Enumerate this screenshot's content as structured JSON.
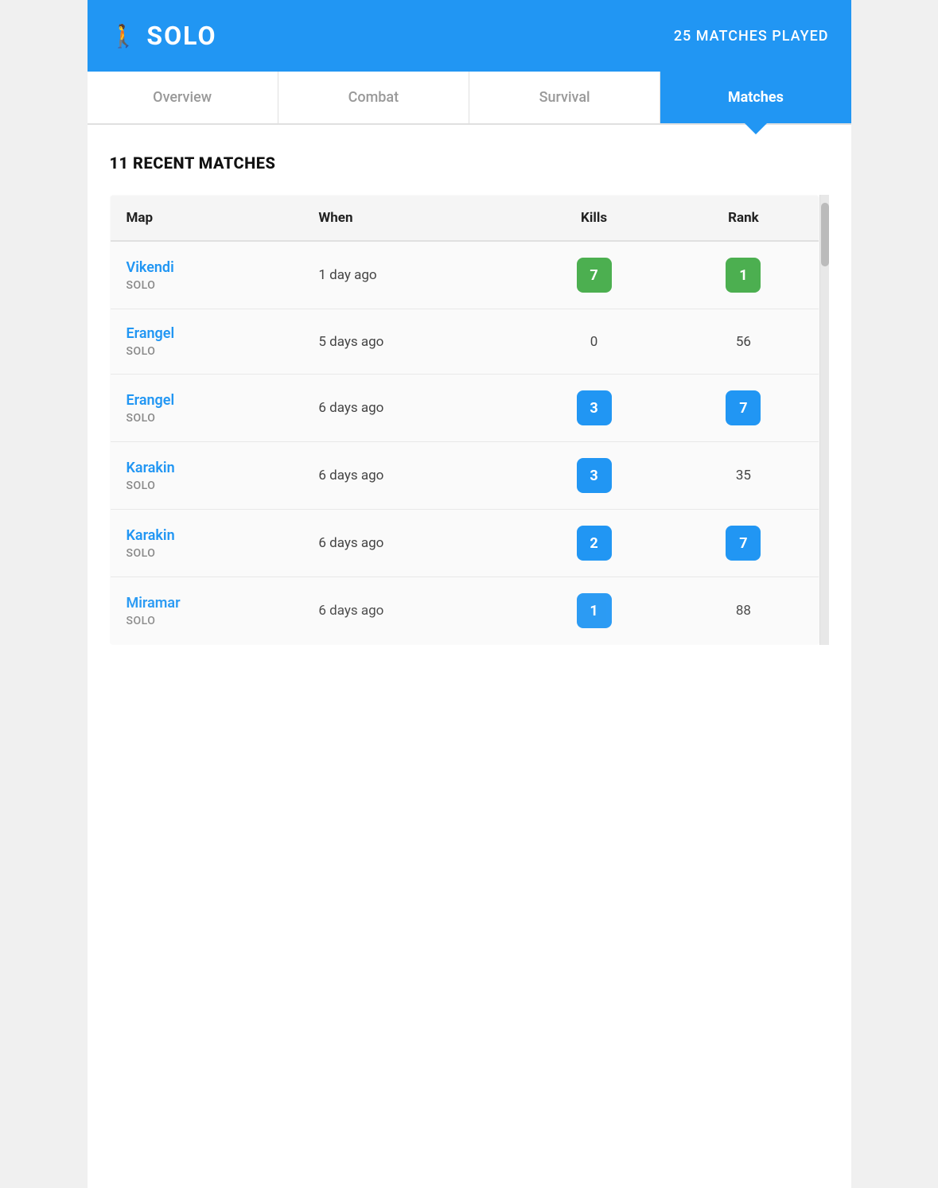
{
  "header": {
    "icon": "🚶",
    "title": "SOLO",
    "matches_played_label": "25 MATCHES PLAYED"
  },
  "tabs": [
    {
      "id": "overview",
      "label": "Overview",
      "active": false
    },
    {
      "id": "combat",
      "label": "Combat",
      "active": false
    },
    {
      "id": "survival",
      "label": "Survival",
      "active": false
    },
    {
      "id": "matches",
      "label": "Matches",
      "active": true
    }
  ],
  "section_title": "11 RECENT MATCHES",
  "table": {
    "columns": [
      "Map",
      "When",
      "Kills",
      "Rank"
    ],
    "rows": [
      {
        "map": "Vikendi",
        "mode": "SOLO",
        "when": "1 day ago",
        "kills": "7",
        "kills_badge": "green",
        "rank": "1",
        "rank_badge": "green"
      },
      {
        "map": "Erangel",
        "mode": "SOLO",
        "when": "5 days ago",
        "kills": "0",
        "kills_badge": null,
        "rank": "56",
        "rank_badge": null
      },
      {
        "map": "Erangel",
        "mode": "SOLO",
        "when": "6 days ago",
        "kills": "3",
        "kills_badge": "blue",
        "rank": "7",
        "rank_badge": "blue"
      },
      {
        "map": "Karakin",
        "mode": "SOLO",
        "when": "6 days ago",
        "kills": "3",
        "kills_badge": "blue",
        "rank": "35",
        "rank_badge": null
      },
      {
        "map": "Karakin",
        "mode": "SOLO",
        "when": "6 days ago",
        "kills": "2",
        "kills_badge": "blue",
        "rank": "7",
        "rank_badge": "blue"
      },
      {
        "map": "Miramar",
        "mode": "SOLO",
        "when": "6 days ago",
        "kills": "1",
        "kills_badge": "blue",
        "rank": "88",
        "rank_badge": null,
        "partial": true
      }
    ]
  },
  "colors": {
    "header_bg": "#2196F3",
    "badge_green": "#4CAF50",
    "badge_blue": "#2196F3",
    "tab_active_bg": "#2196F3",
    "map_link": "#2196F3"
  }
}
